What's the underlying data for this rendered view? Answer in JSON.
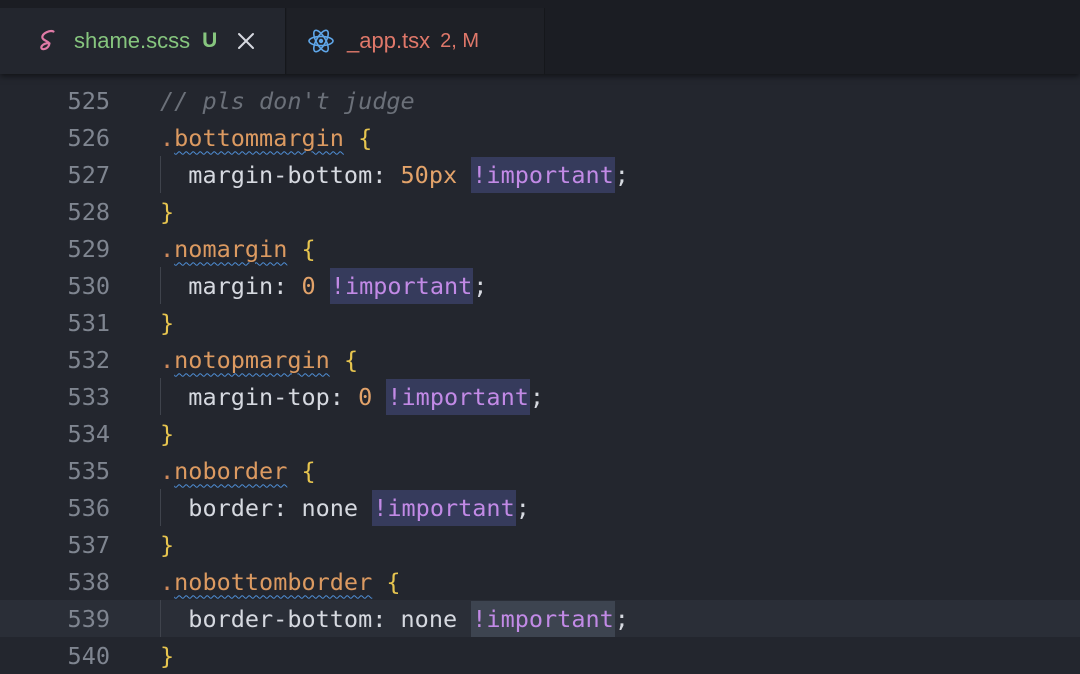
{
  "tabs": [
    {
      "name": "shame.scss",
      "status": "U",
      "icon": "sass-icon",
      "active": true
    },
    {
      "name": "_app.tsx",
      "status": "2, M",
      "icon": "react-icon",
      "active": false
    }
  ],
  "editor": {
    "lines": [
      {
        "n": "525",
        "comment": "// pls don't judge"
      },
      {
        "n": "526",
        "selector": "bottommargin",
        "brace": "{"
      },
      {
        "n": "527",
        "prop": "margin-bottom",
        "value": "50px",
        "numeric": true,
        "important": "!important"
      },
      {
        "n": "528",
        "brace": "}"
      },
      {
        "n": "529",
        "selector": "nomargin",
        "brace": "{"
      },
      {
        "n": "530",
        "prop": "margin",
        "value": "0",
        "numeric": true,
        "important": "!important"
      },
      {
        "n": "531",
        "brace": "}"
      },
      {
        "n": "532",
        "selector": "notopmargin",
        "brace": "{"
      },
      {
        "n": "533",
        "prop": "margin-top",
        "value": "0",
        "numeric": true,
        "important": "!important"
      },
      {
        "n": "534",
        "brace": "}"
      },
      {
        "n": "535",
        "selector": "noborder",
        "brace": "{"
      },
      {
        "n": "536",
        "prop": "border",
        "value": "none",
        "numeric": false,
        "important": "!important"
      },
      {
        "n": "537",
        "brace": "}"
      },
      {
        "n": "538",
        "selector": "nobottomborder",
        "brace": "{"
      },
      {
        "n": "539",
        "prop": "border-bottom",
        "value": "none",
        "numeric": false,
        "important": "!important",
        "current": true
      },
      {
        "n": "540",
        "brace": "}"
      }
    ]
  },
  "colors": {
    "editor_bg": "#23262e",
    "tabbar_bg": "#1b1d23",
    "untracked_green": "#86c57e",
    "modified_red": "#e0786a",
    "selector_orange": "#dc9a61",
    "brace_yellow": "#e7c54f",
    "important_purple": "#c28ae6",
    "squiggle_blue": "#4f8fd6"
  }
}
